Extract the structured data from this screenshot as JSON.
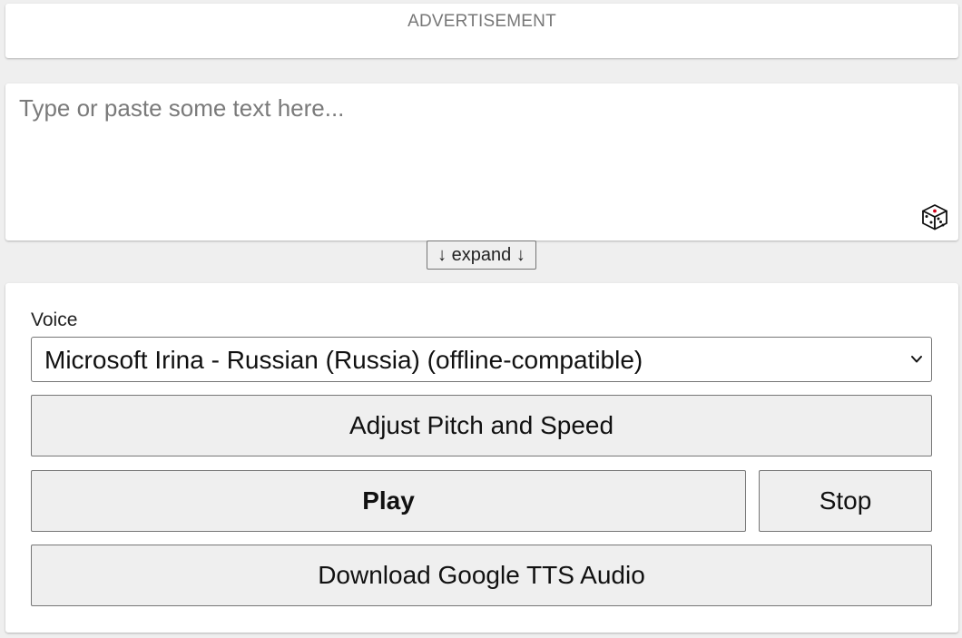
{
  "advertisement": {
    "label": "ADVERTISEMENT"
  },
  "text_area": {
    "placeholder": "Type or paste some text here...",
    "value": "",
    "random_icon": "dice-icon"
  },
  "expand_button": {
    "label": "↓ expand ↓"
  },
  "voice": {
    "label": "Voice",
    "selected": "Microsoft Irina - Russian (Russia) (offline-compatible)",
    "dropdown_icon": "chevron-down-icon"
  },
  "buttons": {
    "adjust_label": "Adjust Pitch and Speed",
    "play_label": "Play",
    "stop_label": "Stop",
    "download_label": "Download Google TTS Audio"
  }
}
